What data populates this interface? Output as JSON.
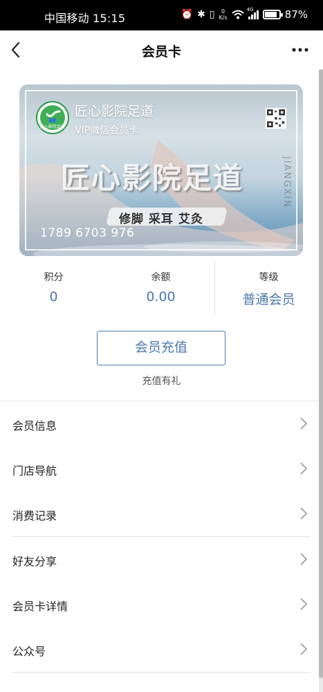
{
  "status_bar": {
    "carrier_time": "中国移动 15:15",
    "net_speed_top": "0",
    "net_speed_unit": "K/s",
    "network_type": "4G",
    "battery_percent_label": "87%",
    "battery_level": 0.87
  },
  "navbar": {
    "title": "会员卡",
    "back_icon": "chevron-left-icon",
    "more_icon": "more-dots-icon"
  },
  "card": {
    "logo_label": "匠心影院足道",
    "shop_name": "匠心影院足道",
    "card_type": "VIP微信会员卡",
    "big_title": "匠心影院足道",
    "vertical_text": "JIANGXIN",
    "services": "修脚 采耳 艾灸",
    "card_number": "1789 6703 976",
    "qr_icon": "qr-code-icon"
  },
  "stats": [
    {
      "label": "积分",
      "value": "0"
    },
    {
      "label": "余额",
      "value": "0.00"
    },
    {
      "label": "等级",
      "value": "普通会员"
    }
  ],
  "recharge": {
    "button_label": "会员充值",
    "note": "充值有礼"
  },
  "menu": [
    {
      "label": "会员信息"
    },
    {
      "label": "门店导航"
    },
    {
      "label": "消费记录"
    },
    {
      "label": "好友分享"
    },
    {
      "label": "会员卡详情"
    },
    {
      "label": "公众号"
    }
  ],
  "colors": {
    "accent": "#4a79ad",
    "brand_green": "#3fae55"
  }
}
